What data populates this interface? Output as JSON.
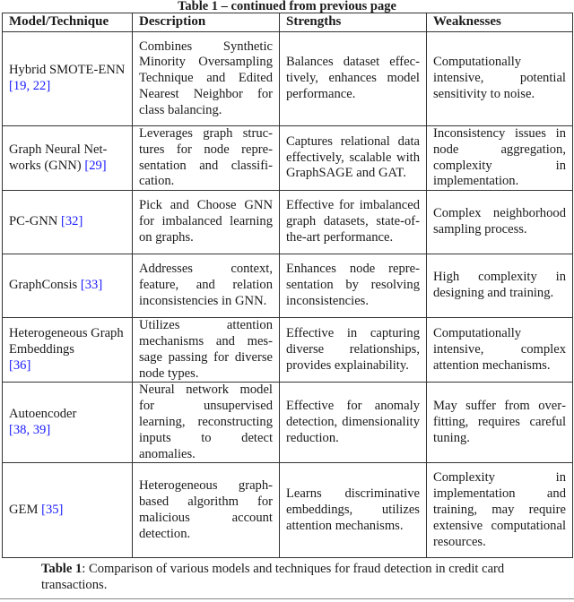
{
  "continued_title": "Table 1 – continued from previous page",
  "headers": [
    "Model/Technique",
    "Description",
    "Strengths",
    "Weaknesses"
  ],
  "rows": [
    {
      "model": "Hybrid SMOTE-ENN",
      "refs": "[19, 22]",
      "description": "Combines Synthetic Minority Oversam­pling Technique and Edited Nearest Neighbor for class balancing.",
      "strengths": "Balances dataset effec­tively, enhances model performance.",
      "weaknesses": "Computationally intensive, potential sensitivity to noise."
    },
    {
      "model": "Graph Neural Net­works (GNN)",
      "refs": "[29]",
      "description": "Leverages graph struc­tures for node repre­sentation and classifi­cation.",
      "strengths": "Captures relational data effectively, scal­able with GraphSAGE and GAT.",
      "weaknesses": "Inconsistency issues in node aggrega­tion, complexity in implementation."
    },
    {
      "model": "PC-GNN",
      "refs": "[32]",
      "description": "Pick and Choose GNN for imbalanced learn­ing on graphs.",
      "strengths": "Effective for imbal­anced graph datasets, state-of-the-art performance.",
      "weaknesses": "Complex neigh­borhood sampling process."
    },
    {
      "model": "GraphConsis",
      "refs": "[33]",
      "description": "Addresses context, feature, and rela­tion inconsistencies in GNN.",
      "strengths": "Enhances node repre­sentation by resolving inconsistencies.",
      "weaknesses": "High complexity in designing and training."
    },
    {
      "model": "Heterogeneous Graph Embeddings",
      "refs": "[36]",
      "description": "Utilizes attention mechanisms and mes­sage passing for diverse node types.",
      "strengths": "Effective in capturing diverse relationships, provides explainability.",
      "weaknesses": "Computationally intensive, complex attention mechanisms."
    },
    {
      "model": "Autoencoder",
      "refs": "[38, 39]",
      "description": "Neural network model for unsupervised learning, reconstruct­ing inputs to detect anomalies.",
      "strengths": "Effective for anomaly detection, dimension­ality reduction.",
      "weaknesses": "May suffer from over­fitting, requires careful tuning."
    },
    {
      "model": "GEM",
      "refs": "[35]",
      "description": "Heterogeneous graph-based algorithm for malicious account detection.",
      "strengths": "Learns discriminative embeddings, utilizes attention mechanisms.",
      "weaknesses": "Complexity in implementation and training, may require exten­sive computational resources."
    }
  ],
  "caption": {
    "label": "Table 1",
    "text": ": Comparison of various models and techniques for fraud detection in credit card transactions."
  },
  "colors": {
    "citation_link": "#1a1aff",
    "text": "#1a1a1a",
    "border": "#333333"
  }
}
